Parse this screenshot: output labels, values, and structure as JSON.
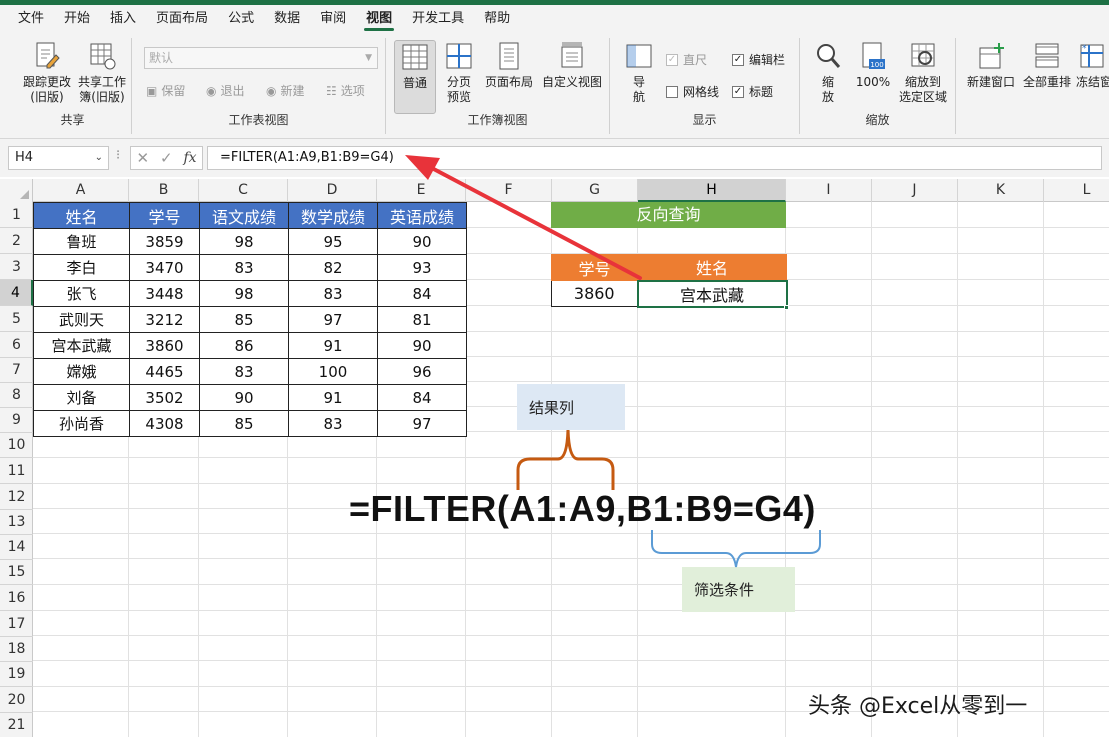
{
  "menu": [
    "文件",
    "开始",
    "插入",
    "页面布局",
    "公式",
    "数据",
    "审阅",
    "视图",
    "开发工具",
    "帮助"
  ],
  "menu_active_index": 7,
  "ribbon": {
    "share": {
      "track_changes": "跟踪更改\n(旧版)",
      "share_workbook": "共享工作\n簿(旧版)",
      "label": "共享"
    },
    "sheet_view": {
      "dropdown_value": "默认",
      "keep": "保留",
      "exit": "退出",
      "new": "新建",
      "options": "选项",
      "label": "工作表视图"
    },
    "workbook_view": {
      "normal": "普通",
      "page_break": "分页\n预览",
      "page_layout": "页面布局",
      "custom_view": "自定义视图",
      "label": "工作簿视图"
    },
    "show": {
      "navigation": "导\n航",
      "ruler": "直尺",
      "gridlines": "网格线",
      "formula_bar": "编辑栏",
      "headings": "标题",
      "label": "显示"
    },
    "zoom": {
      "zoom": "缩\n放",
      "hundred": "100%",
      "zoom_selection": "缩放到\n选定区域",
      "label": "缩放"
    },
    "window": {
      "new_window": "新建窗口",
      "arrange_all": "全部重排",
      "freeze": "冻结窗"
    }
  },
  "formula_bar": {
    "name_box": "H4",
    "formula": "=FILTER(A1:A9,B1:B9=G4)"
  },
  "columns": [
    "A",
    "B",
    "C",
    "D",
    "E",
    "F",
    "G",
    "H",
    "I",
    "J",
    "K",
    "L"
  ],
  "selected_column": "H",
  "rows": [
    "1",
    "2",
    "3",
    "4",
    "5",
    "6",
    "7",
    "8",
    "9",
    "10",
    "11",
    "12",
    "13",
    "14",
    "15",
    "16",
    "17",
    "18",
    "19",
    "20",
    "21"
  ],
  "selected_row": "4",
  "table": {
    "headers": [
      "姓名",
      "学号",
      "语文成绩",
      "数学成绩",
      "英语成绩"
    ],
    "rows": [
      [
        "鲁班",
        "3859",
        "98",
        "95",
        "90"
      ],
      [
        "李白",
        "3470",
        "83",
        "82",
        "93"
      ],
      [
        "张飞",
        "3448",
        "98",
        "83",
        "84"
      ],
      [
        "武则天",
        "3212",
        "85",
        "97",
        "81"
      ],
      [
        "宫本武藏",
        "3860",
        "86",
        "91",
        "90"
      ],
      [
        "嫦娥",
        "4465",
        "83",
        "100",
        "96"
      ],
      [
        "刘备",
        "3502",
        "90",
        "91",
        "84"
      ],
      [
        "孙尚香",
        "4308",
        "85",
        "83",
        "97"
      ]
    ]
  },
  "lookup": {
    "title": "反向查询",
    "header_id": "学号",
    "header_name": "姓名",
    "id_value": "3860",
    "result_value": "宫本武藏"
  },
  "annotations": {
    "result_column": "结果列",
    "filter_condition": "筛选条件",
    "big_formula": "=FILTER(A1:A9,B1:B9=G4)"
  },
  "colors": {
    "header_blue": "#4472c4",
    "lookup_green": "#70ad47",
    "lookup_orange": "#ed7d31",
    "excel_green": "#1e7145",
    "arrow_red": "#e8333a",
    "brace_brown": "#c55a11",
    "brace_blue": "#5b9bd5"
  },
  "watermark": "头条 @Excel从零到一"
}
